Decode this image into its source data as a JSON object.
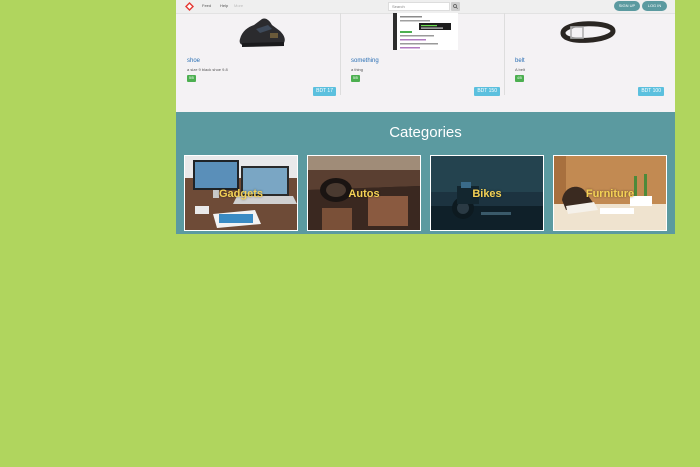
{
  "navbar": {
    "links": [
      "Feed",
      "Help",
      "More"
    ],
    "search_placeholder": "Search",
    "signup_label": "SIGN UP",
    "login_label": "LOG IN"
  },
  "products": [
    {
      "name": "shoe",
      "description": "a size 9 black shoe 9.8",
      "badge": "5/5",
      "price": "BDT 17"
    },
    {
      "name": "something",
      "description": "a thing",
      "badge": "5/5",
      "price": "BDT 150"
    },
    {
      "name": "belt",
      "description": "A belt",
      "badge": "4/5",
      "price": "BDT 100"
    }
  ],
  "categories": {
    "title": "Categories",
    "items": [
      "Gadgets",
      "Autos",
      "Bikes",
      "Furniture"
    ]
  },
  "colors": {
    "background": "#b0d55e",
    "accent": "#5b9aa0",
    "price_badge": "#5bc0de",
    "rating_badge": "#4caf50",
    "category_label": "#f4d155"
  }
}
